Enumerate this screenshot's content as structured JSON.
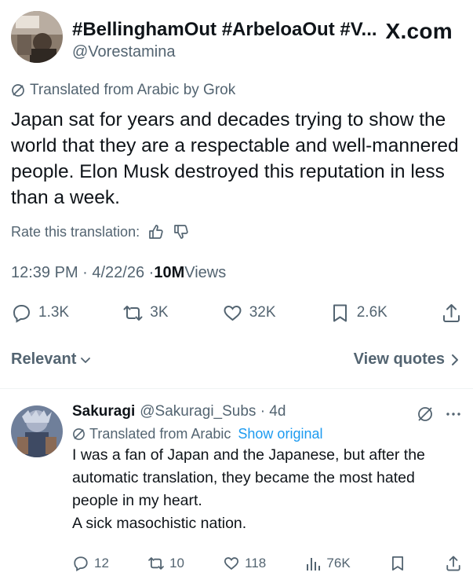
{
  "post": {
    "display_name": "#BellinghamOut #ArbeloaOut #V...",
    "handle": "@Vorestamina",
    "brand": "X.com",
    "translated_label": "Translated from Arabic by Grok",
    "text": "Japan sat for years and decades trying to show the world that they are a respectable and well-mannered people. Elon Musk destroyed this reputation in less than a week.",
    "rate_label": "Rate this translation:",
    "timestamp": "12:39 PM · 4/22/26 · ",
    "views_count": "10M",
    "views_label": " Views",
    "actions": {
      "replies": "1.3K",
      "reposts": "3K",
      "likes": "32K",
      "bookmarks": "2.6K"
    }
  },
  "sort": {
    "relevant": "Relevant",
    "view_quotes": "View quotes"
  },
  "reply": {
    "display_name": "Sakuragi",
    "handle": "@Sakuragi_Subs · 4d",
    "translated_label": "Translated from Arabic",
    "show_original": "Show original",
    "text_lines": [
      "I was a fan of Japan and the Japanese, but after the automatic translation, they became the most hated people in my heart.",
      "A sick masochistic nation."
    ],
    "actions": {
      "replies": "12",
      "reposts": "10",
      "likes": "118",
      "views": "76K"
    }
  },
  "colors": {
    "text": "#0f1419",
    "muted": "#536471",
    "link": "#1d9bf0",
    "divider": "#eff3f4"
  }
}
